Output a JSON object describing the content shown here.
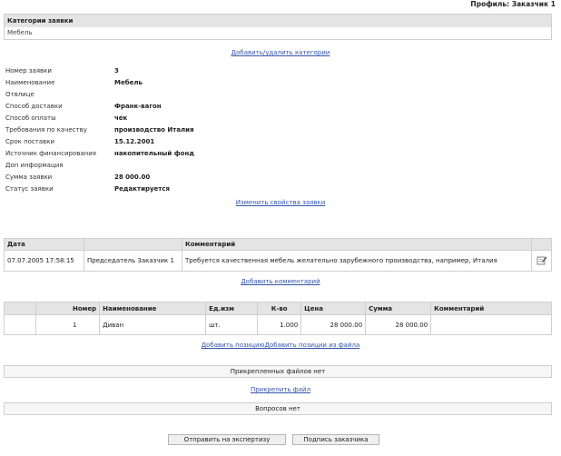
{
  "header": {
    "profile": "Профиль: Заказчик 1"
  },
  "category": {
    "title": "Категории заявки",
    "value": "Мебель"
  },
  "links": {
    "add_remove_category": "Добавить/удалить категории",
    "change_properties": "Изменить свойства заявки",
    "add_comment": "Добавить комментарий",
    "add_position": "Добавить позицию",
    "add_position_from_file": "Добавить позиции из файла",
    "attach_file": "Прикрепить файл"
  },
  "properties": [
    {
      "label": "Номер заявки",
      "value": "3"
    },
    {
      "label": "Наименование",
      "value": "Мебель"
    },
    {
      "label": "Отвлице",
      "value": ""
    },
    {
      "label": "Способ доставки",
      "value": "Франк-вагон"
    },
    {
      "label": "Способ оплаты",
      "value": "чек"
    },
    {
      "label": "Требования по качеству",
      "value": "производство Италия"
    },
    {
      "label": "Срок поставки",
      "value": "15.12.2001"
    },
    {
      "label": "Источник финансирования",
      "value": "накопительный фонд"
    },
    {
      "label": "Доп информация",
      "value": ""
    },
    {
      "label": "Сумма заявки",
      "value": "28 000.00"
    },
    {
      "label": "Статус заявки",
      "value": "Редактируется"
    }
  ],
  "comments": {
    "headers": [
      "Дата",
      "",
      "Комментарий"
    ],
    "rows": [
      {
        "date": "07.07.2005 17:58:15",
        "author": "Председатель Заказчик 1",
        "text": "Требуется качественная мебель желательно зарубежного производства, например, Италия"
      }
    ]
  },
  "items": {
    "headers": [
      "",
      "Номер",
      "Наименование",
      "Ед.изм",
      "К-во",
      "Цена",
      "Сумма",
      "Комментарий"
    ],
    "rows": [
      {
        "num": "1",
        "name": "Диван",
        "unit": "шт.",
        "qty": "1.000",
        "price": "28 000.00",
        "sum": "28 000.00",
        "comment": ""
      }
    ]
  },
  "status": {
    "no_files": "Прикрепленных файлов нет",
    "no_questions": "Вопросов нет"
  },
  "buttons": {
    "send_expert": "Отправить на экспертизу",
    "sign_customer": "Подпись заказчика"
  }
}
